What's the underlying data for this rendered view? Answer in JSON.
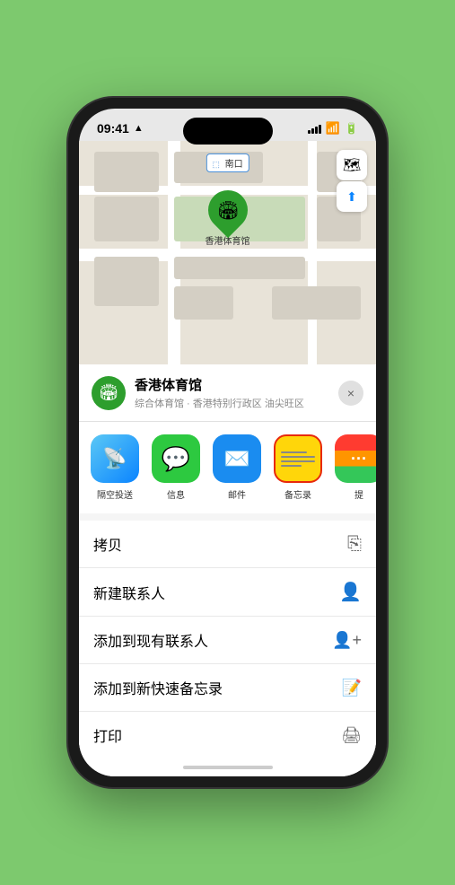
{
  "status": {
    "time": "09:41",
    "location_icon": "▲"
  },
  "map": {
    "label": "南口",
    "pin_label": "香港体育馆",
    "controls": {
      "map_icon": "🗺",
      "location_icon": "⬆"
    }
  },
  "sheet": {
    "venue_name": "香港体育馆",
    "venue_subtitle": "综合体育馆 · 香港特别行政区 油尖旺区",
    "close_label": "×"
  },
  "share_items": [
    {
      "label": "隔空投送",
      "type": "airdrop"
    },
    {
      "label": "信息",
      "type": "message"
    },
    {
      "label": "邮件",
      "type": "mail"
    },
    {
      "label": "备忘录",
      "type": "notes"
    },
    {
      "label": "提",
      "type": "more"
    }
  ],
  "actions": [
    {
      "label": "拷贝",
      "icon": "copy"
    },
    {
      "label": "新建联系人",
      "icon": "person"
    },
    {
      "label": "添加到现有联系人",
      "icon": "person-add"
    },
    {
      "label": "添加到新快速备忘录",
      "icon": "note"
    },
    {
      "label": "打印",
      "icon": "print"
    }
  ]
}
